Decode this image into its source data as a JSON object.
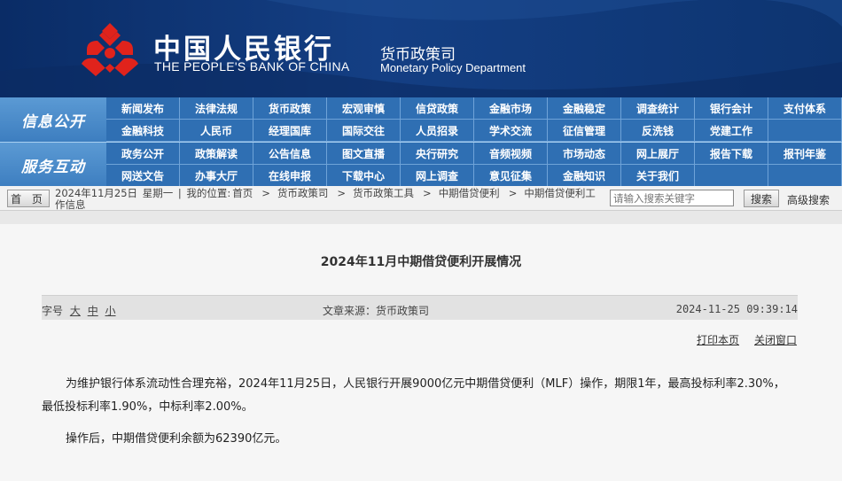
{
  "header": {
    "bank_cn": "中国人民银行",
    "bank_en": "THE PEOPLE'S BANK OF CHINA",
    "dept_cn": "货币政策司",
    "dept_en": "Monetary Policy Department",
    "emblem_color": "#e0231c"
  },
  "nav": {
    "info_label": "信息公开",
    "info_items": [
      "新闻发布",
      "法律法规",
      "货币政策",
      "宏观审慎",
      "信贷政策",
      "金融市场",
      "金融稳定",
      "调查统计",
      "银行会计",
      "支付体系",
      "金融科技",
      "人民币",
      "经理国库",
      "国际交往",
      "人员招录",
      "学术交流",
      "征信管理",
      "反洗钱",
      "党建工作",
      ""
    ],
    "service_label": "服务互动",
    "service_items": [
      "政务公开",
      "政策解读",
      "公告信息",
      "图文直播",
      "央行研究",
      "音频视频",
      "市场动态",
      "网上展厅",
      "报告下载",
      "报刊年鉴",
      "网送文告",
      "办事大厅",
      "在线申报",
      "下载中心",
      "网上调查",
      "意见征集",
      "金融知识",
      "关于我们",
      "",
      ""
    ]
  },
  "crumb": {
    "home_label": "首 页",
    "date": "2024年11月25日",
    "weekday": "星期一",
    "location_label": "我的位置:",
    "path": [
      "首页",
      "货币政策司",
      "货币政策工具",
      "中期借贷便利",
      "中期借贷便利工作信息"
    ],
    "separator": ">",
    "search_placeholder": "请输入搜索关键字",
    "search_button": "搜索",
    "advanced_search": "高级搜索"
  },
  "article": {
    "title": "2024年11月中期借贷便利开展情况",
    "fontsize_label": "字号",
    "fontsize_options": [
      "大",
      "中",
      "小"
    ],
    "source": "文章来源：货币政策司",
    "date": "2024-11-25 09:39:14",
    "print_label": "打印本页",
    "close_label": "关闭窗口",
    "paragraphs": [
      "为维护银行体系流动性合理充裕，2024年11月25日，人民银行开展9000亿元中期借贷便利（MLF）操作，期限1年，最高投标利率2.30%，最低投标利率1.90%，中标利率2.00%。",
      "操作后，中期借贷便利余额为62390亿元。"
    ]
  }
}
